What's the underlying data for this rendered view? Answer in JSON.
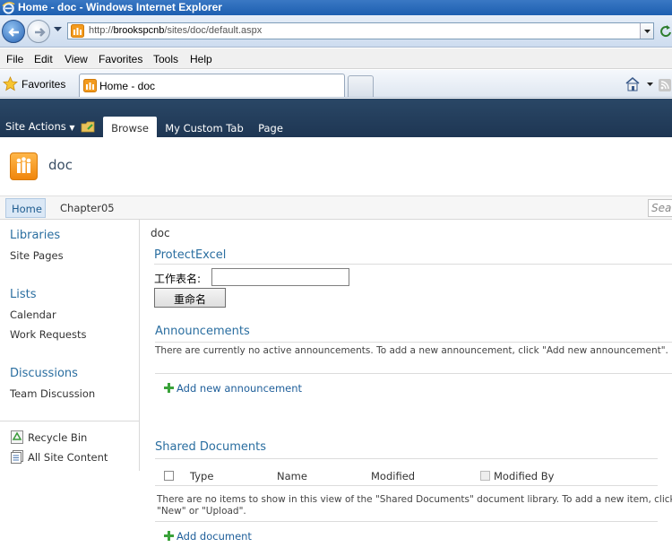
{
  "window": {
    "title": "Home - doc - Windows Internet Explorer"
  },
  "address": {
    "url_prefix": "http://",
    "url_host": "brookspcnb",
    "url_path": "/sites/doc/default.aspx"
  },
  "menu": [
    "File",
    "Edit",
    "View",
    "Favorites",
    "Tools",
    "Help"
  ],
  "favorites": {
    "label": "Favorites",
    "tab_title": "Home - doc"
  },
  "ribbon": {
    "site_actions": "Site Actions",
    "tabs": [
      "Browse",
      "My Custom Tab",
      "Page"
    ]
  },
  "site": {
    "title": "doc"
  },
  "topnav": {
    "items": [
      "Home",
      "Chapter05"
    ],
    "search_placeholder": "Sea"
  },
  "quicklaunch": {
    "libraries": {
      "heading": "Libraries",
      "items": [
        "Site Pages"
      ]
    },
    "lists": {
      "heading": "Lists",
      "items": [
        "Calendar",
        "Work Requests"
      ]
    },
    "discussions": {
      "heading": "Discussions",
      "items": [
        "Team Discussion"
      ]
    },
    "bottom": [
      "Recycle Bin",
      "All Site Content"
    ]
  },
  "main": {
    "breadcrumb": "doc",
    "protect_excel": {
      "title": "ProtectExcel",
      "label": "工作表名:",
      "input_value": "",
      "button": "重命名"
    },
    "announcements": {
      "title": "Announcements",
      "empty_msg": "There are currently no active announcements. To add a new announcement, click \"Add new announcement\".",
      "add_link": "Add new announcement"
    },
    "shared_docs": {
      "title": "Shared Documents",
      "columns": [
        "Type",
        "Name",
        "Modified",
        "Modified By"
      ],
      "empty_msg_line1": "There are no items to show in this view of the \"Shared Documents\" document library. To add a new item, click",
      "empty_msg_line2": "\"New\" or \"Upload\".",
      "add_link": "Add document"
    }
  },
  "colors": {
    "ribbon": "#24405e",
    "link": "#2a6ea0",
    "accent_orange": "#f0860c"
  }
}
